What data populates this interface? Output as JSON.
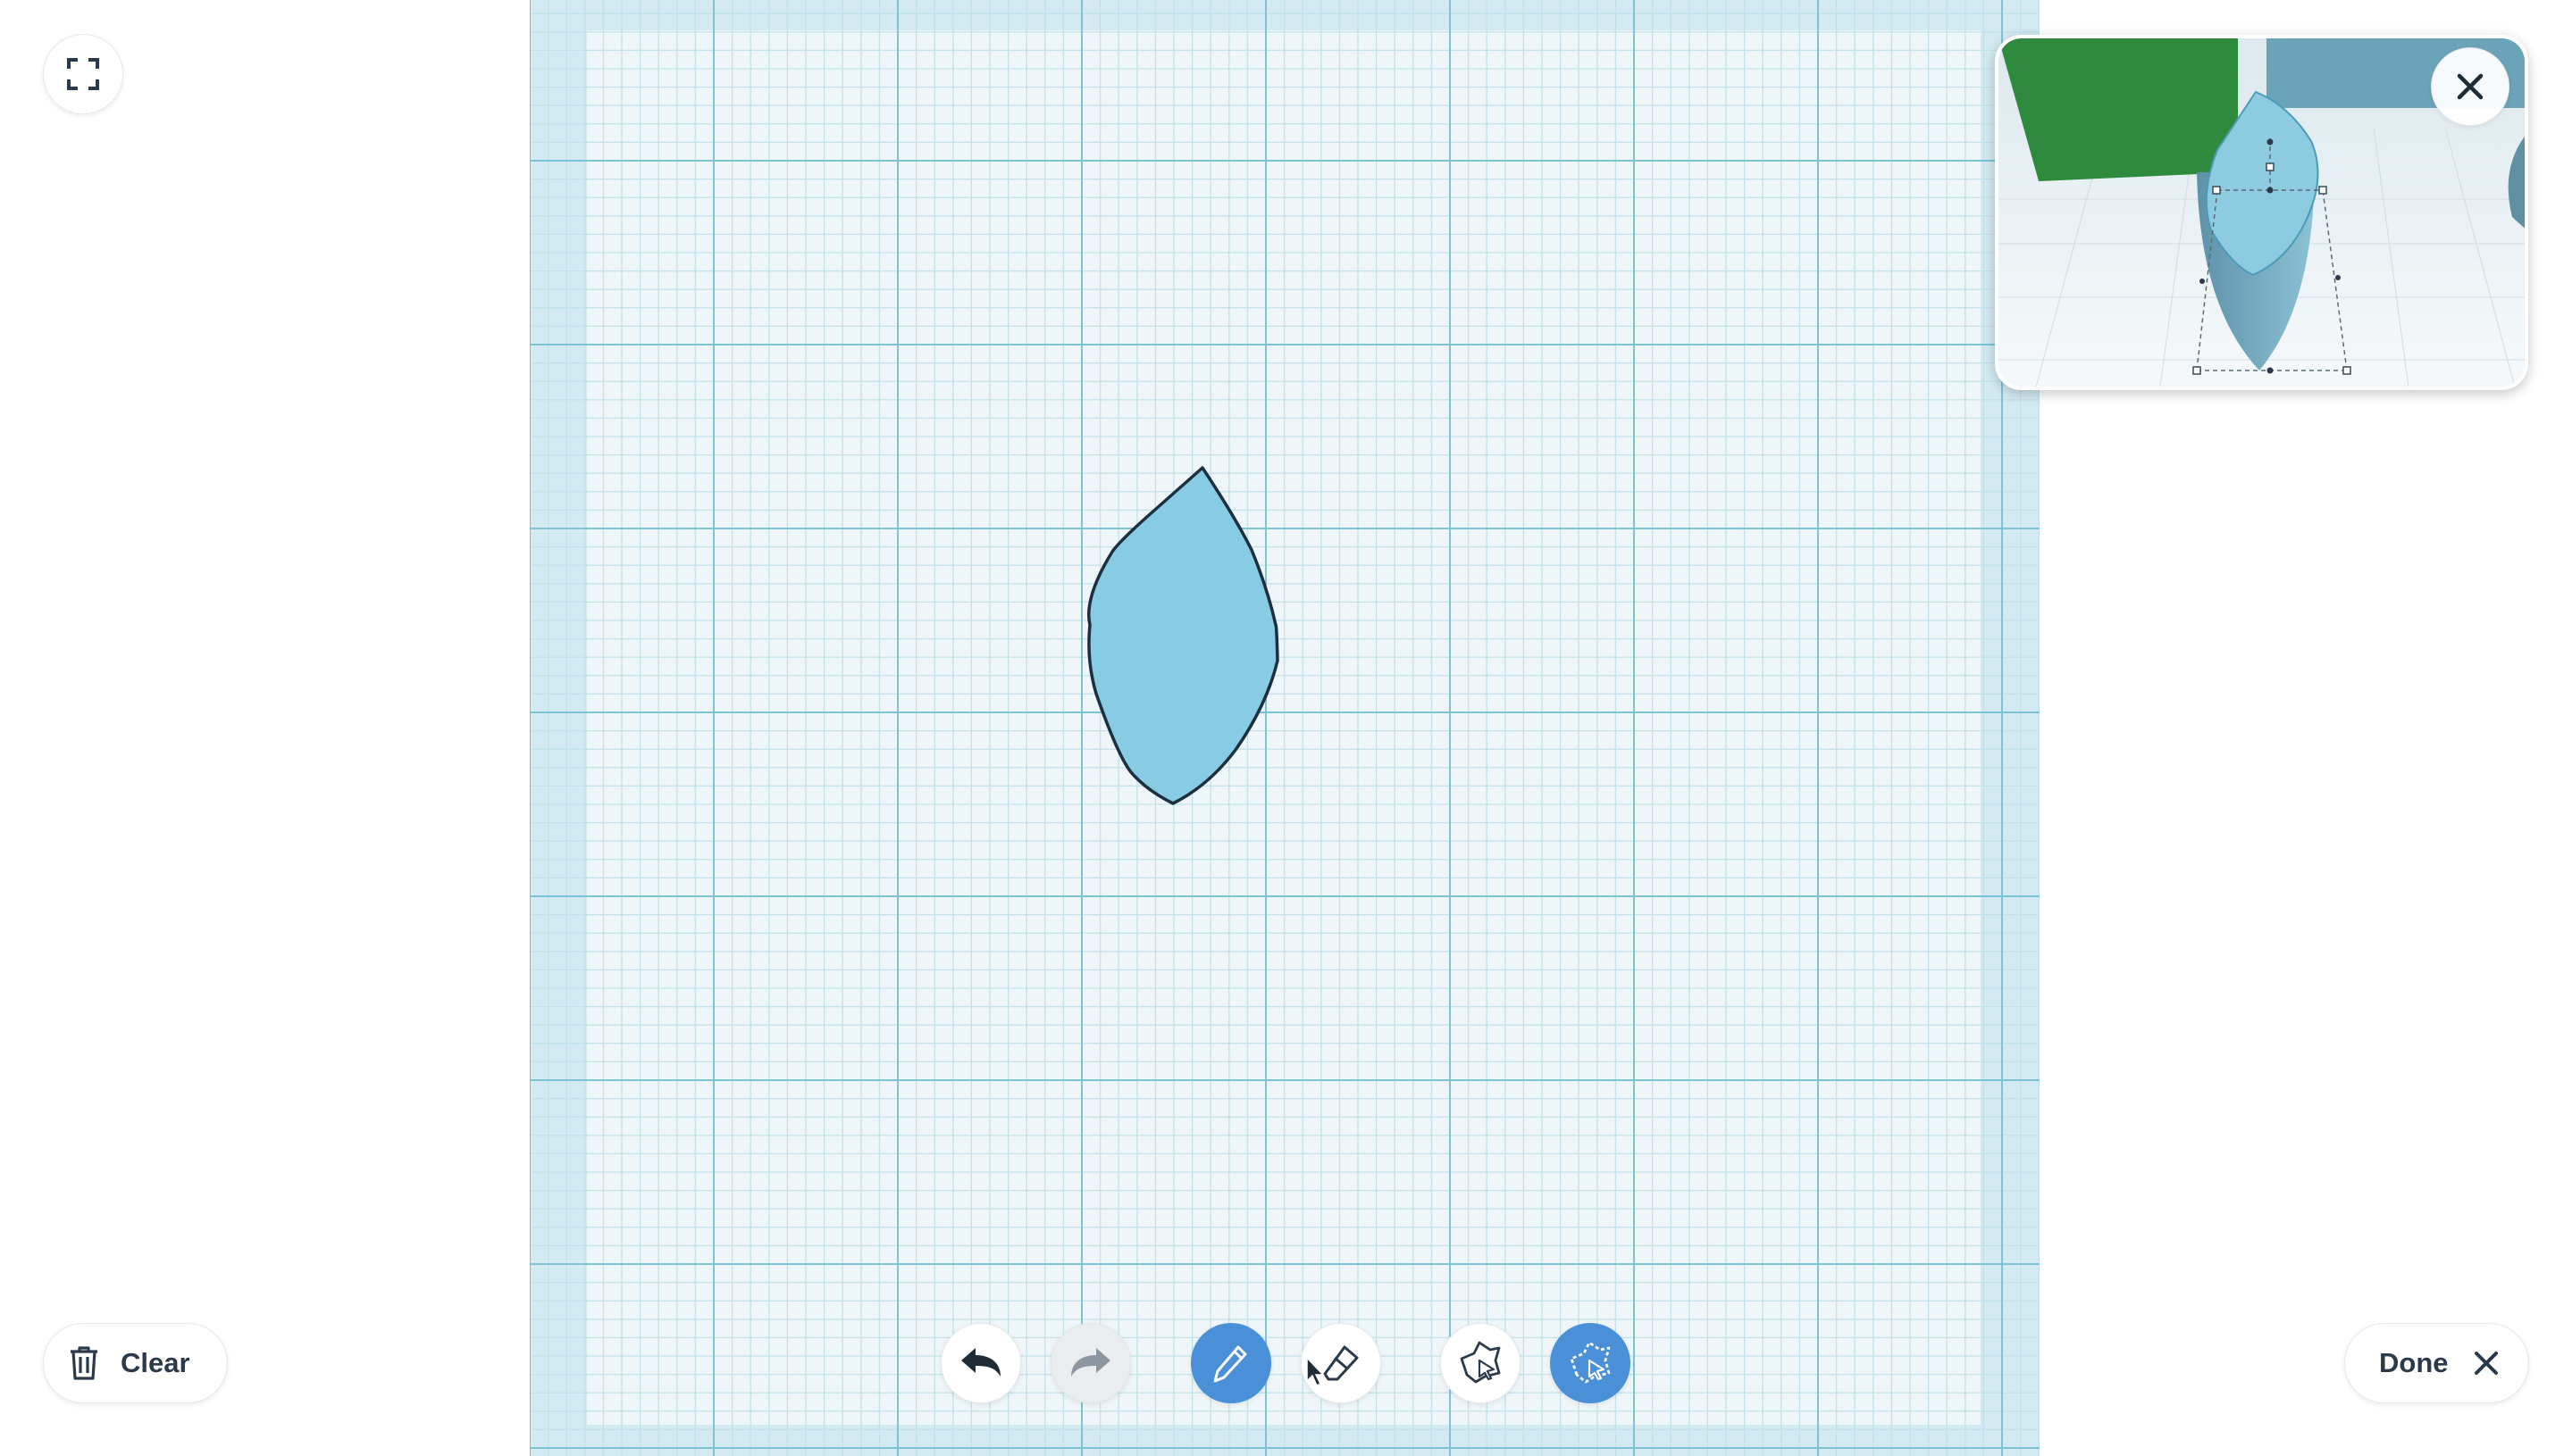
{
  "top_left": {
    "fullscreen_icon": "fullscreen-icon"
  },
  "bottom_left": {
    "clear_label": "Clear",
    "clear_icon": "trash-icon"
  },
  "bottom_right": {
    "done_label": "Done",
    "done_icon": "close-icon"
  },
  "toolbar": {
    "tools": [
      {
        "name": "undo-button",
        "icon": "undo-icon",
        "state": "enabled"
      },
      {
        "name": "redo-button",
        "icon": "redo-icon",
        "state": "disabled"
      },
      {
        "name": "pencil-tool-button",
        "icon": "pencil-icon",
        "state": "active"
      },
      {
        "name": "eraser-tool-button",
        "icon": "eraser-icon",
        "state": "enabled"
      },
      {
        "name": "select-shape-button",
        "icon": "shape-select-icon",
        "state": "enabled"
      },
      {
        "name": "smooth-shape-button",
        "icon": "shape-smooth-icon",
        "state": "active"
      }
    ]
  },
  "preview": {
    "close_icon": "close-icon"
  },
  "colors": {
    "grid_bg": "#eef6f9",
    "grid_border": "#d3eaf2",
    "grid_minor": "#c2e1eb",
    "grid_major": "#7cc3d6",
    "shape_fill": "#87cce4",
    "shape_stroke": "#1c2f3f",
    "accent": "#4a90d9",
    "preview_green": "#2e8b3e",
    "preview_blue": "#6ba3b8"
  }
}
